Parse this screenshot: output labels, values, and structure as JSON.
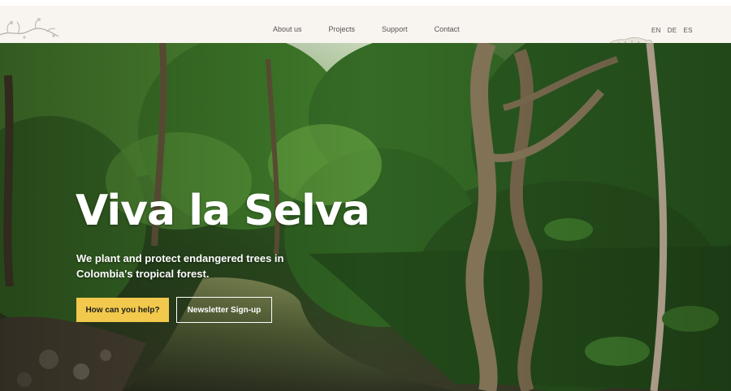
{
  "nav": {
    "links": [
      "About us",
      "Projects",
      "Support",
      "Contact"
    ],
    "languages": [
      "EN",
      "DE",
      "ES"
    ]
  },
  "hero": {
    "title": "Viva la Selva",
    "subtitle": "We plant and protect endangered trees in Colombia's tropical forest.",
    "primary_button": "How can you help?",
    "secondary_button": "Newsletter Sign-up"
  },
  "colors": {
    "accent": "#f2c94c",
    "nav_background": "#f8f4ef",
    "text_light": "#ffffff"
  },
  "icons": {
    "logo": "vine-branch-icon",
    "mascot": "jaguar-icon"
  }
}
